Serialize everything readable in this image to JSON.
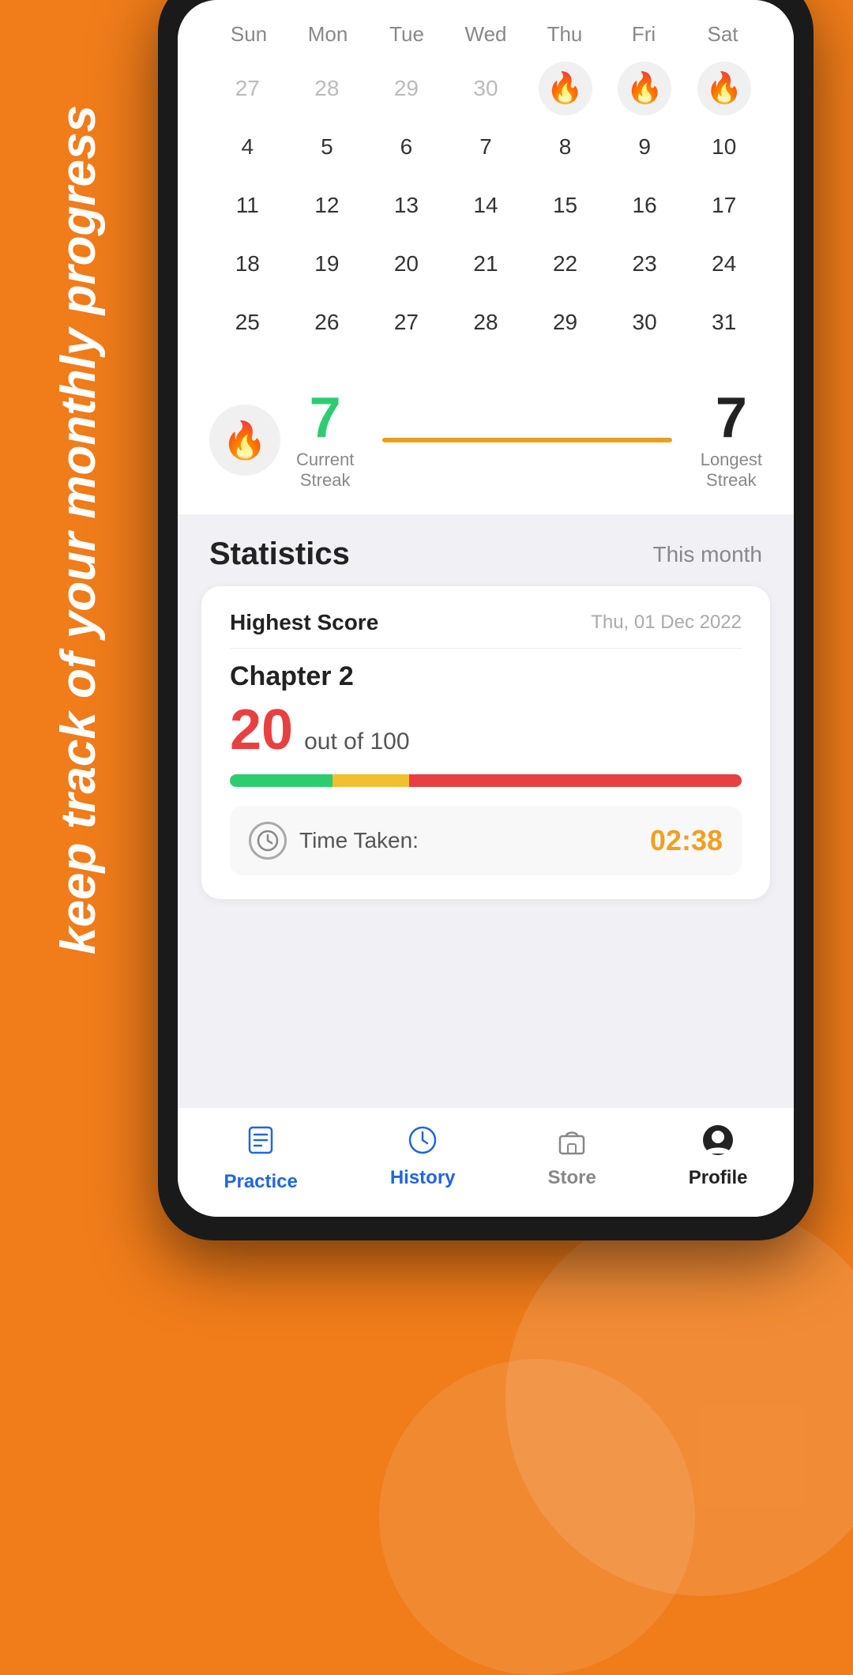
{
  "app": {
    "tagline": "keep track of your monthly progress"
  },
  "calendar": {
    "day_headers": [
      "Sun",
      "Mon",
      "Tue",
      "Wed",
      "Thu",
      "Fri",
      "Sat"
    ],
    "rows": [
      [
        {
          "num": "27",
          "grey": true,
          "fire": false
        },
        {
          "num": "28",
          "grey": true,
          "fire": false
        },
        {
          "num": "29",
          "grey": true,
          "fire": false
        },
        {
          "num": "30",
          "grey": true,
          "fire": false
        },
        {
          "num": "🔥",
          "grey": false,
          "fire": true
        },
        {
          "num": "🔥",
          "grey": false,
          "fire": true
        },
        {
          "num": "🔥",
          "grey": false,
          "fire": true
        }
      ],
      [
        {
          "num": "4",
          "grey": false,
          "fire": false
        },
        {
          "num": "5",
          "grey": false,
          "fire": false
        },
        {
          "num": "6",
          "grey": false,
          "fire": false
        },
        {
          "num": "7",
          "grey": false,
          "fire": false
        },
        {
          "num": "8",
          "grey": false,
          "fire": false
        },
        {
          "num": "9",
          "grey": false,
          "fire": false
        },
        {
          "num": "10",
          "grey": false,
          "fire": false
        }
      ],
      [
        {
          "num": "11",
          "grey": false,
          "fire": false
        },
        {
          "num": "12",
          "grey": false,
          "fire": false
        },
        {
          "num": "13",
          "grey": false,
          "fire": false
        },
        {
          "num": "14",
          "grey": false,
          "fire": false
        },
        {
          "num": "15",
          "grey": false,
          "fire": false
        },
        {
          "num": "16",
          "grey": false,
          "fire": false
        },
        {
          "num": "17",
          "grey": false,
          "fire": false
        }
      ],
      [
        {
          "num": "18",
          "grey": false,
          "fire": false
        },
        {
          "num": "19",
          "grey": false,
          "fire": false
        },
        {
          "num": "20",
          "grey": false,
          "fire": false
        },
        {
          "num": "21",
          "grey": false,
          "fire": false
        },
        {
          "num": "22",
          "grey": false,
          "fire": false
        },
        {
          "num": "23",
          "grey": false,
          "fire": false
        },
        {
          "num": "24",
          "grey": false,
          "fire": false
        }
      ],
      [
        {
          "num": "25",
          "grey": false,
          "fire": false
        },
        {
          "num": "26",
          "grey": false,
          "fire": false
        },
        {
          "num": "27",
          "grey": false,
          "fire": false
        },
        {
          "num": "28",
          "grey": false,
          "fire": false
        },
        {
          "num": "29",
          "grey": false,
          "fire": false
        },
        {
          "num": "30",
          "grey": false,
          "fire": false
        },
        {
          "num": "31",
          "grey": false,
          "fire": false
        }
      ]
    ]
  },
  "streak": {
    "current_number": "7",
    "current_label": "Current\nStreak",
    "longest_number": "7",
    "longest_label": "Longest\nStreak"
  },
  "statistics": {
    "title": "Statistics",
    "period": "This month",
    "highest_score_label": "Highest Score",
    "date": "Thu, 01 Dec 2022",
    "chapter": "Chapter 2",
    "score": "20",
    "out_of": "out of 100",
    "time_taken_label": "Time Taken:",
    "time_value": "02:38"
  },
  "nav": {
    "items": [
      {
        "label": "Practice",
        "icon": "📋",
        "active": false
      },
      {
        "label": "History",
        "icon": "🕐",
        "active": false
      },
      {
        "label": "Store",
        "icon": "🏪",
        "active": false
      },
      {
        "label": "Profile",
        "icon": "👤",
        "active": true
      }
    ]
  }
}
